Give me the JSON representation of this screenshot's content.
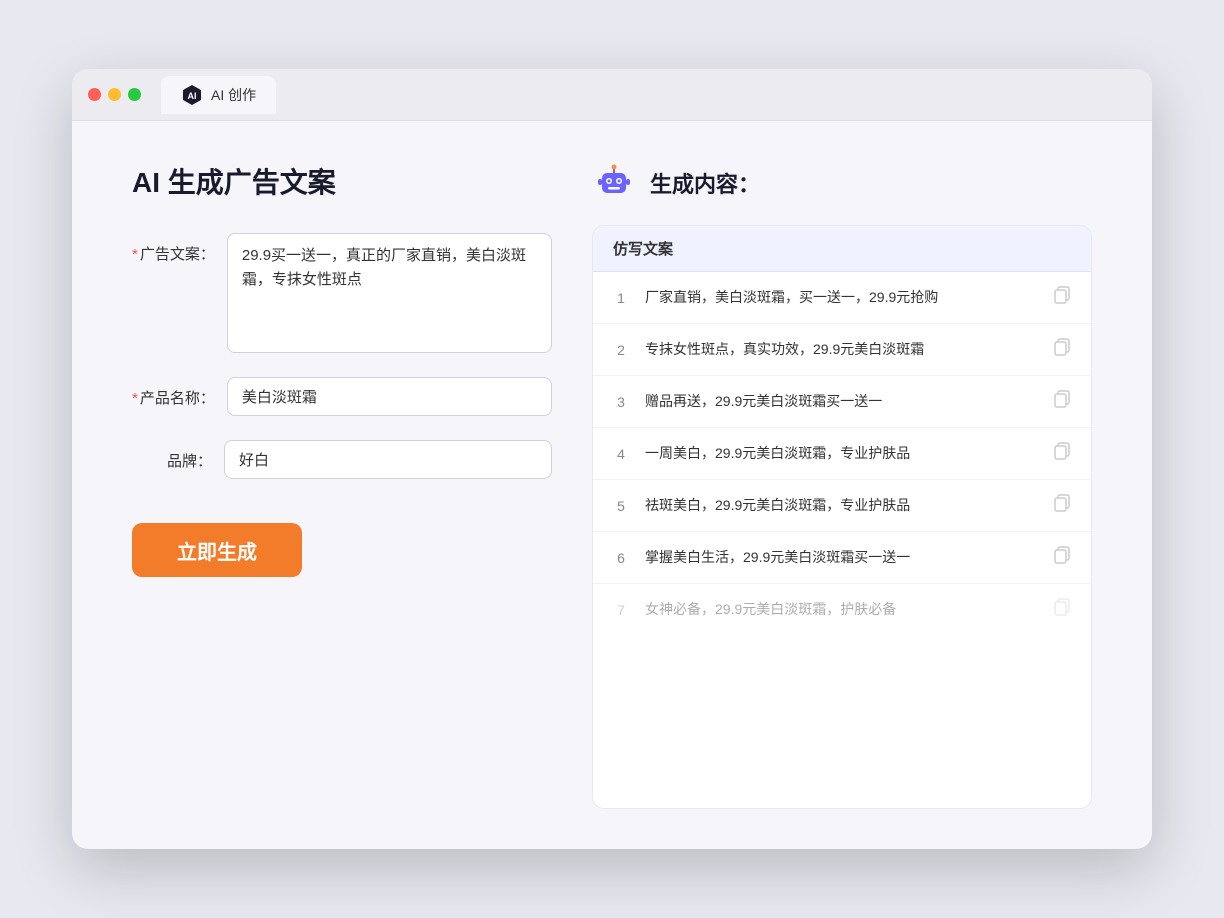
{
  "window": {
    "tab_label": "AI 创作"
  },
  "page": {
    "title": "AI 生成广告文案",
    "right_title": "生成内容："
  },
  "form": {
    "ad_copy_label": "广告文案：",
    "ad_copy_value": "29.9买一送一，真正的厂家直销，美白淡斑霜，专抹女性斑点",
    "product_name_label": "产品名称：",
    "product_name_value": "美白淡斑霜",
    "brand_label": "品牌：",
    "brand_value": "好白",
    "generate_btn_label": "立即生成"
  },
  "results": {
    "header": "仿写文案",
    "items": [
      {
        "num": "1",
        "text": "厂家直销，美白淡斑霜，买一送一，29.9元抢购",
        "faded": false
      },
      {
        "num": "2",
        "text": "专抹女性斑点，真实功效，29.9元美白淡斑霜",
        "faded": false
      },
      {
        "num": "3",
        "text": "赠品再送，29.9元美白淡斑霜买一送一",
        "faded": false
      },
      {
        "num": "4",
        "text": "一周美白，29.9元美白淡斑霜，专业护肤品",
        "faded": false
      },
      {
        "num": "5",
        "text": "祛斑美白，29.9元美白淡斑霜，专业护肤品",
        "faded": false
      },
      {
        "num": "6",
        "text": "掌握美白生活，29.9元美白淡斑霜买一送一",
        "faded": false
      },
      {
        "num": "7",
        "text": "女神必备，29.9元美白淡斑霜，护肤必备",
        "faded": true
      }
    ]
  }
}
